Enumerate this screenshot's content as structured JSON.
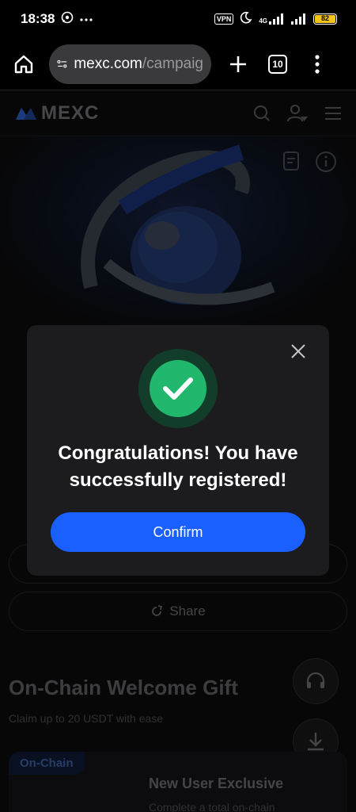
{
  "status_bar": {
    "time": "18:38",
    "vpn": "VPN",
    "network": "4G",
    "battery": "82"
  },
  "browser": {
    "url_host": "mexc.com",
    "url_path": "/campaig",
    "tab_count": "10"
  },
  "site": {
    "logo": "MEXC"
  },
  "page": {
    "share_label": "Share",
    "gift_title": "On-Chain Welcome Gift",
    "gift_subtitle": "Claim up to 20 USDT with ease",
    "card_tag": "On-Chain",
    "card_title": "New User Exclusive",
    "card_desc": "Complete a total on-chain"
  },
  "modal": {
    "message": "Congratulations! You have successfully registered!",
    "confirm_label": "Confirm"
  },
  "colors": {
    "accent": "#1a5fff",
    "success": "#21b86e",
    "modal_bg": "#1c1c1f"
  }
}
